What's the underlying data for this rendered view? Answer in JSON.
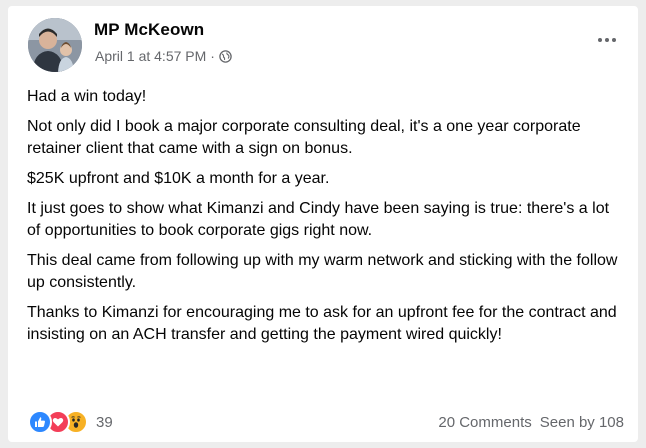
{
  "post": {
    "author": "MP McKeown",
    "timestamp": "April 1 at 4:57 PM",
    "privacy_icon": "globe-icon",
    "separator": "·",
    "paragraphs": [
      "Had a win today!",
      "Not only did I book a major corporate consulting deal, it's a one year corporate retainer client that came with a sign on bonus.",
      "$25K upfront and $10K a month for a year.",
      "It just goes to show what Kimanzi and Cindy have been saying is true: there's a lot of opportunities to book corporate gigs right now.",
      "This deal came from following up with my warm network and sticking with the follow up consistently.",
      "Thanks to Kimanzi for encouraging me to ask for an upfront fee for the contract and insisting on an ACH transfer and  getting the payment wired quickly!"
    ]
  },
  "footer": {
    "reactions": [
      "like",
      "love",
      "wow"
    ],
    "reaction_count": "39",
    "comments": "20 Comments",
    "seen_by": "Seen by 108"
  },
  "colors": {
    "like": "#2d88ff",
    "love": "#f33e58",
    "wow": "#f7b125",
    "secondary_text": "#65676b"
  }
}
